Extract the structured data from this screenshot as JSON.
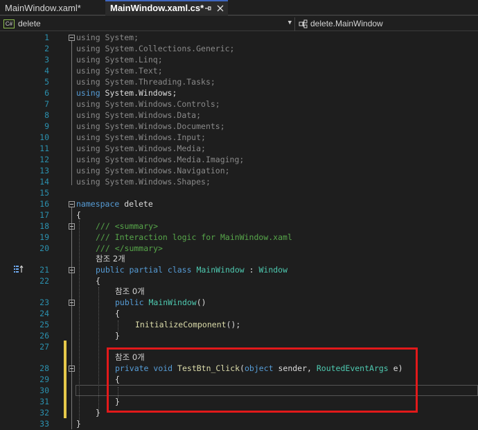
{
  "tabs": [
    {
      "title": "MainWindow.xaml*",
      "active": false
    },
    {
      "title": "MainWindow.xaml.cs*",
      "active": true,
      "pin_icon": "pin-icon",
      "close_icon": "close-icon"
    }
  ],
  "nav": {
    "project": "delete",
    "member": "delete.MainWindow",
    "project_icon": "csharp-project-icon",
    "member_icon": "class-icon"
  },
  "colors": {
    "keyword": "#569cd6",
    "type": "#4ec9b0",
    "method": "#dcdcaa",
    "comment": "#57a64a",
    "line_number": "#2b91af",
    "change_marker": "#e6c84a",
    "highlight_box": "#e2191a",
    "tab_accent": "#3e66c0"
  },
  "editor": {
    "lines": [
      {
        "n": "1",
        "kw": "using",
        "rest": " System;"
      },
      {
        "n": "2",
        "kw": "using",
        "rest": " System.Collections.Generic;"
      },
      {
        "n": "3",
        "kw": "using",
        "rest": " System.Linq;"
      },
      {
        "n": "4",
        "kw": "using",
        "rest": " System.Text;"
      },
      {
        "n": "5",
        "kw": "using",
        "rest": " System.Threading.Tasks;"
      },
      {
        "n": "6",
        "kw": "using",
        "rest": " System.Windows;"
      },
      {
        "n": "7",
        "kw": "using",
        "rest": " System.Windows.Controls;"
      },
      {
        "n": "8",
        "kw": "using",
        "rest": " System.Windows.Data;"
      },
      {
        "n": "9",
        "kw": "using",
        "rest": " System.Windows.Documents;"
      },
      {
        "n": "10",
        "kw": "using",
        "rest": " System.Windows.Input;"
      },
      {
        "n": "11",
        "kw": "using",
        "rest": " System.Windows.Media;"
      },
      {
        "n": "12",
        "kw": "using",
        "rest": " System.Windows.Media.Imaging;"
      },
      {
        "n": "13",
        "kw": "using",
        "rest": " System.Windows.Navigation;"
      },
      {
        "n": "14",
        "kw": "using",
        "rest": " System.Windows.Shapes;"
      },
      {
        "n": "15"
      },
      {
        "n": "16",
        "kw": "namespace",
        "rest": " delete"
      },
      {
        "n": "17",
        "rest": "{"
      },
      {
        "n": "18",
        "comment": "/// <summary>"
      },
      {
        "n": "19",
        "comment": "/// Interaction logic for MainWindow.xaml"
      },
      {
        "n": "20",
        "comment": "/// </summary>"
      },
      {
        "n": "21",
        "codelens": "참조 2개",
        "kw1": "public",
        "kw2": "partial",
        "kw3": "class",
        "name": "MainWindow",
        "sep": " : ",
        "base": "Window"
      },
      {
        "n": "22",
        "rest": "{"
      },
      {
        "n": "23",
        "codelens": "참조 0개",
        "kw": "public",
        "name": "MainWindow",
        "rest": "()"
      },
      {
        "n": "24",
        "rest": "{"
      },
      {
        "n": "25",
        "fn": "InitializeComponent",
        "rest": "();"
      },
      {
        "n": "26",
        "rest": "}"
      },
      {
        "n": "27"
      },
      {
        "n": "28",
        "codelens": "참조 0개",
        "kw1": "private",
        "kw2": "void",
        "name": "TestBtn_Click",
        "p1": "(",
        "p1type": "object",
        "p1name": " sender, ",
        "p2type": "RoutedEventArgs",
        "p2name": " e)"
      },
      {
        "n": "29",
        "rest": "{"
      },
      {
        "n": "30"
      },
      {
        "n": "31",
        "rest": "}"
      },
      {
        "n": "32",
        "rest": "}"
      },
      {
        "n": "33",
        "rest": "}"
      }
    ]
  }
}
